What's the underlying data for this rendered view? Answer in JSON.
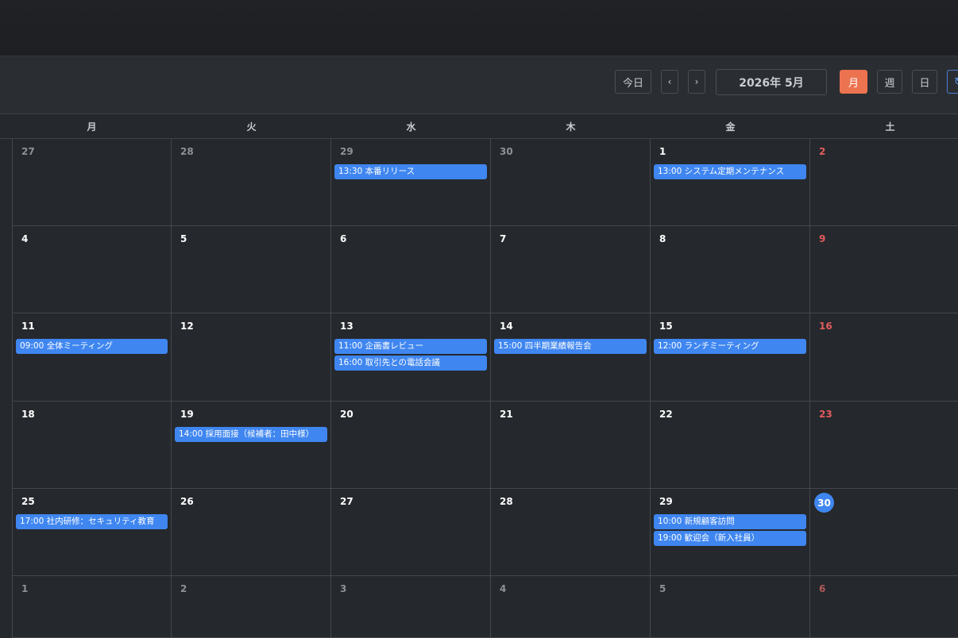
{
  "toolbar": {
    "today_label": "今日",
    "prev_label": "‹",
    "next_label": "›",
    "current_month": "2026年 5月",
    "view_month_label": "月",
    "view_week_label": "週",
    "view_day_label": "日",
    "refresh_label": "↻"
  },
  "weekdays": [
    "月",
    "火",
    "水",
    "木",
    "金",
    "土"
  ],
  "weeks": [
    [
      {
        "day": "27",
        "other": true
      },
      {
        "day": "28",
        "other": true
      },
      {
        "day": "29",
        "other": true,
        "events": [
          "13:30 本番リリース"
        ]
      },
      {
        "day": "30",
        "other": true
      },
      {
        "day": "1",
        "events": [
          "13:00 システム定期メンテナンス"
        ]
      },
      {
        "day": "2",
        "sat": true
      }
    ],
    [
      {
        "day": "4"
      },
      {
        "day": "5"
      },
      {
        "day": "6"
      },
      {
        "day": "7"
      },
      {
        "day": "8"
      },
      {
        "day": "9",
        "sat": true
      }
    ],
    [
      {
        "day": "11",
        "events": [
          "09:00 全体ミーティング"
        ]
      },
      {
        "day": "12"
      },
      {
        "day": "13",
        "events": [
          "11:00 企画書レビュー",
          "16:00 取引先との電話会議"
        ]
      },
      {
        "day": "14",
        "events": [
          "15:00 四半期業績報告会"
        ]
      },
      {
        "day": "15",
        "events": [
          "12:00 ランチミーティング"
        ]
      },
      {
        "day": "16",
        "sat": true
      }
    ],
    [
      {
        "day": "18"
      },
      {
        "day": "19",
        "events": [
          "14:00 採用面接（候補者：田中様）"
        ]
      },
      {
        "day": "20"
      },
      {
        "day": "21"
      },
      {
        "day": "22"
      },
      {
        "day": "23",
        "sat": true
      }
    ],
    [
      {
        "day": "25",
        "events": [
          "17:00 社内研修：セキュリティ教育"
        ]
      },
      {
        "day": "26"
      },
      {
        "day": "27"
      },
      {
        "day": "28"
      },
      {
        "day": "29",
        "events": [
          "10:00 新規顧客訪問",
          "19:00 歓迎会（新入社員）"
        ]
      },
      {
        "day": "30",
        "sat": true,
        "today": true
      }
    ],
    [
      {
        "day": "1",
        "other": true
      },
      {
        "day": "2",
        "other": true
      },
      {
        "day": "3",
        "other": true
      },
      {
        "day": "4",
        "other": true
      },
      {
        "day": "5",
        "other": true
      },
      {
        "day": "6",
        "other": true,
        "sat": true
      }
    ]
  ],
  "colors": {
    "accent": "#ec7350",
    "event": "#3f86f0",
    "saturday": "#e25c5c",
    "background": "#25282c"
  }
}
